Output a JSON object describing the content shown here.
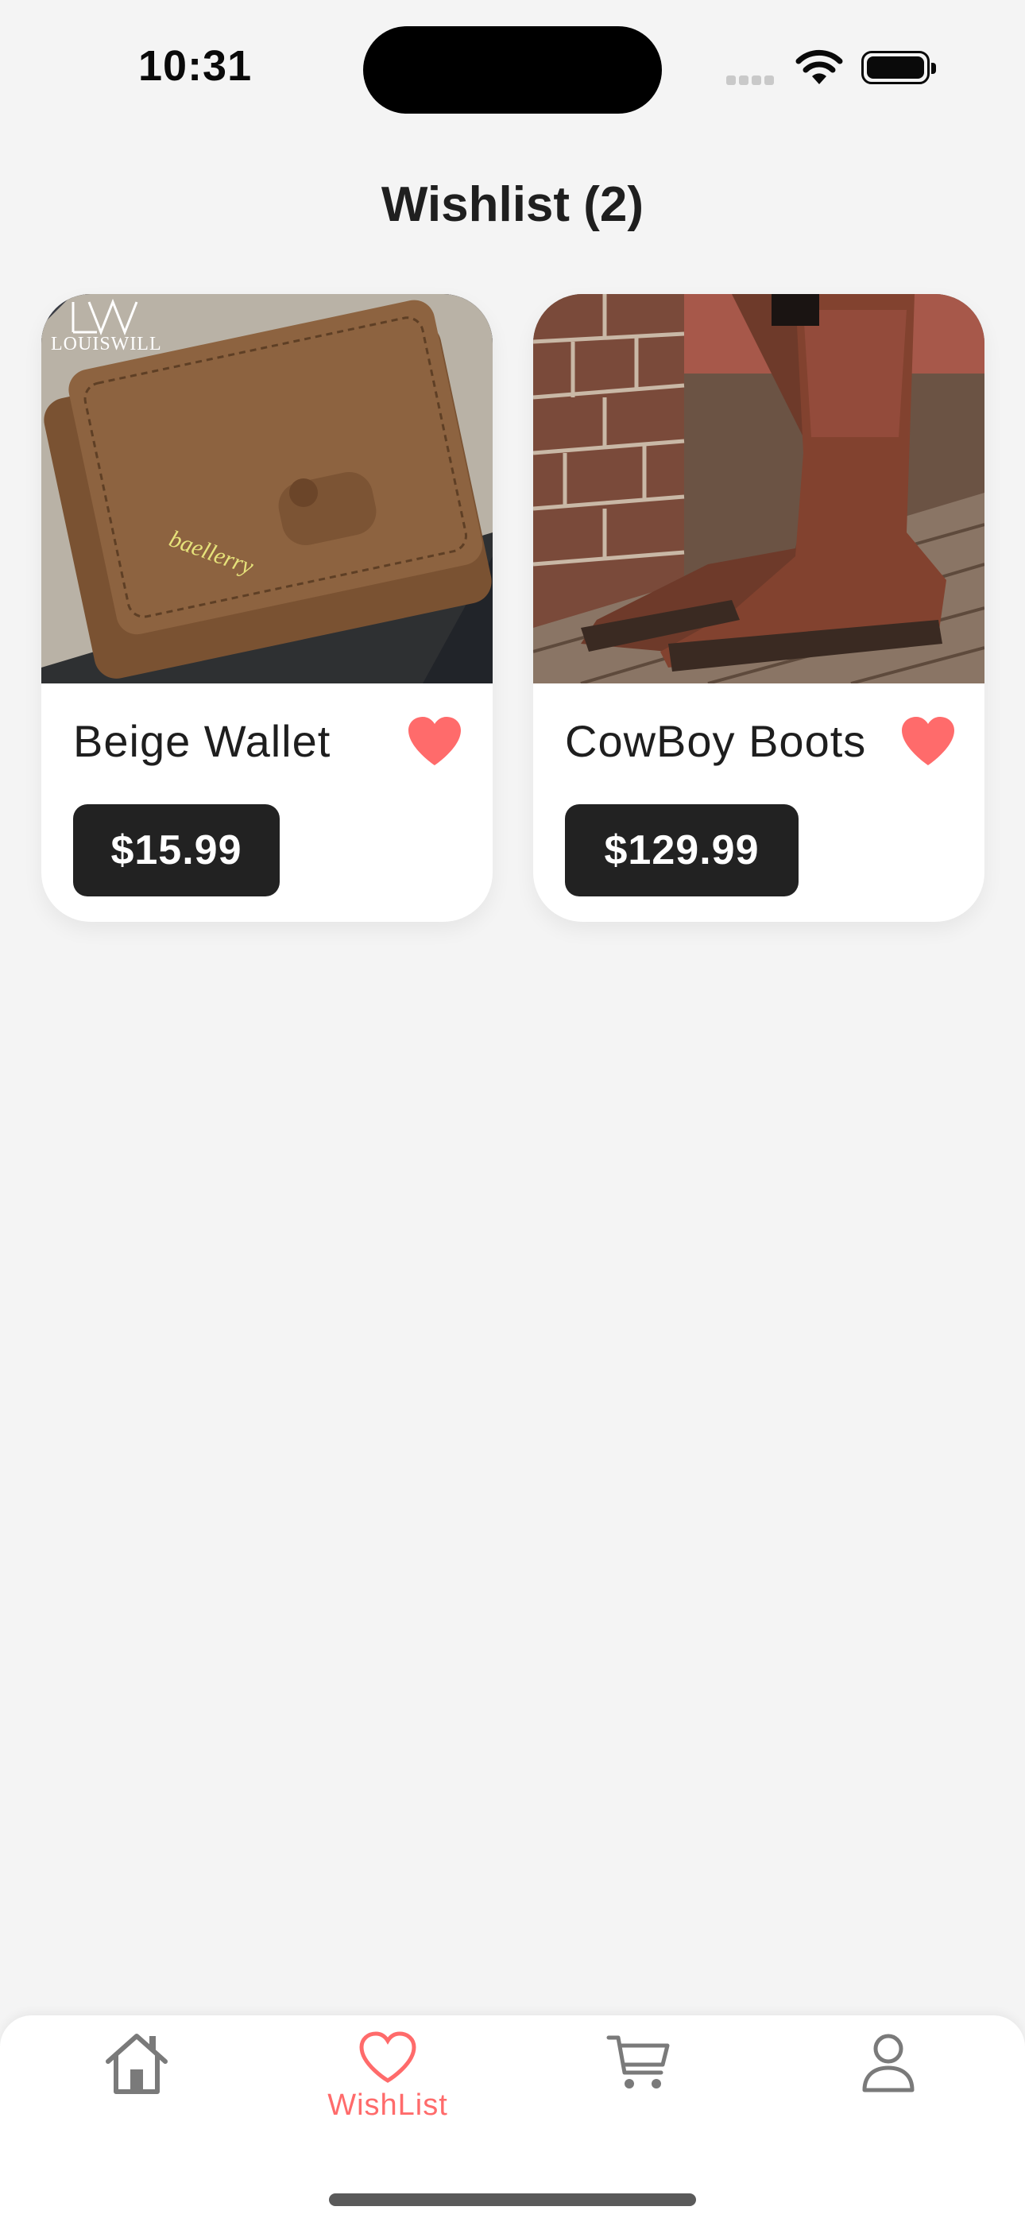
{
  "status_bar": {
    "time": "10:31"
  },
  "header": {
    "title": "Wishlist (2)"
  },
  "products": [
    {
      "name": "Beige Wallet",
      "price": "$15.99",
      "favorited": true,
      "brand_logo": "LOUISWILL",
      "image_label": "baellerry"
    },
    {
      "name": "CowBoy Boots",
      "price": "$129.99",
      "favorited": true
    }
  ],
  "tab_bar": {
    "items": [
      {
        "icon": "home-icon",
        "label": ""
      },
      {
        "icon": "heart-icon",
        "label": "WishList",
        "active": true
      },
      {
        "icon": "cart-icon",
        "label": ""
      },
      {
        "icon": "profile-icon",
        "label": ""
      }
    ]
  },
  "colors": {
    "accent": "#ff6b6b",
    "price_bg": "#222222",
    "background": "#f4f4f4",
    "icon_inactive": "#7a7a7a"
  }
}
